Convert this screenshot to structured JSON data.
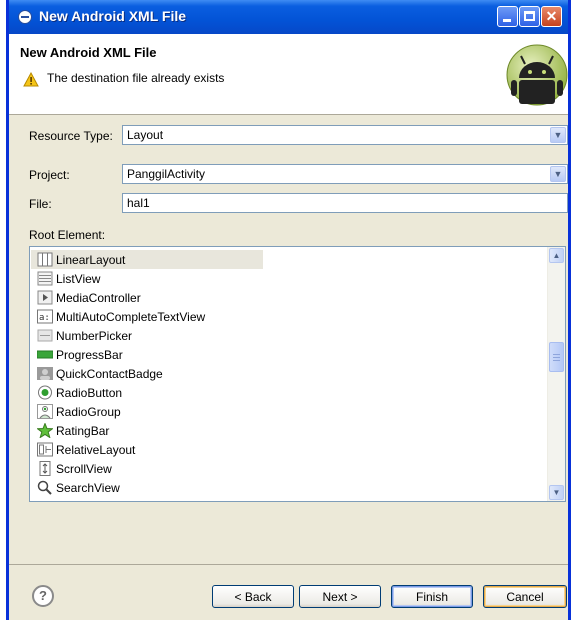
{
  "window": {
    "title": "New Android XML File"
  },
  "header": {
    "title": "New Android XML File",
    "message": "The destination file already exists"
  },
  "form": {
    "resource_type_label": "Resource Type:",
    "resource_type_value": "Layout",
    "project_label": "Project:",
    "project_value": "PanggilActivity",
    "file_label": "File:",
    "file_value": "hal1",
    "root_element_label": "Root Element:"
  },
  "root_elements": [
    {
      "label": "LinearLayout",
      "icon": "linear-layout-icon",
      "selected": true
    },
    {
      "label": "ListView",
      "icon": "list-view-icon"
    },
    {
      "label": "MediaController",
      "icon": "media-controller-icon"
    },
    {
      "label": "MultiAutoCompleteTextView",
      "icon": "multi-autocomplete-icon"
    },
    {
      "label": "NumberPicker",
      "icon": "number-picker-icon"
    },
    {
      "label": "ProgressBar",
      "icon": "progress-bar-icon"
    },
    {
      "label": "QuickContactBadge",
      "icon": "quick-contact-badge-icon"
    },
    {
      "label": "RadioButton",
      "icon": "radio-button-icon"
    },
    {
      "label": "RadioGroup",
      "icon": "radio-group-icon"
    },
    {
      "label": "RatingBar",
      "icon": "rating-bar-icon"
    },
    {
      "label": "RelativeLayout",
      "icon": "relative-layout-icon"
    },
    {
      "label": "ScrollView",
      "icon": "scroll-view-icon"
    },
    {
      "label": "SearchView",
      "icon": "search-view-icon"
    }
  ],
  "buttons": {
    "help": "?",
    "back": "< Back",
    "next": "Next >",
    "finish": "Finish",
    "cancel": "Cancel"
  },
  "icon_badge_text": "a:",
  "colors": {
    "titlebar": "#0353d6",
    "dialog_bg": "#ece9d8",
    "android_green": "#a4c639"
  }
}
